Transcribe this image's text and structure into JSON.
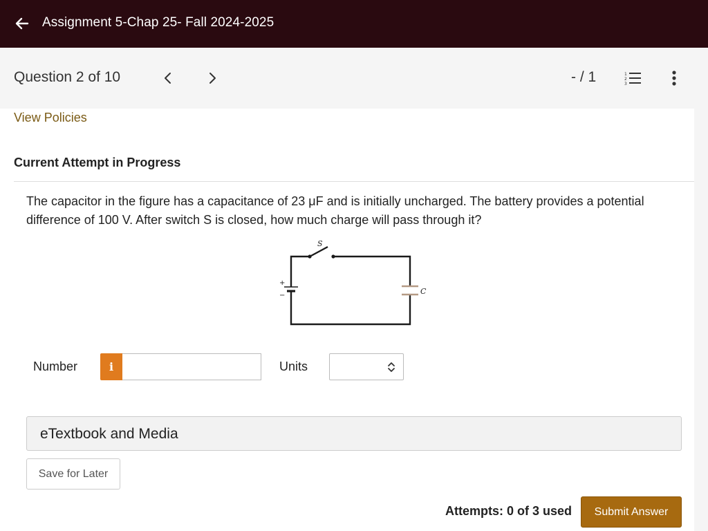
{
  "header": {
    "back_icon": "arrow-left-icon",
    "title": "Assignment 5-Chap 25- Fall 2024-2025"
  },
  "question_nav": {
    "counter": "Question 2 of 10",
    "prev_icon": "chevron-left-icon",
    "next_icon": "chevron-right-icon",
    "score": "- / 1",
    "list_icon": "numbered-list-icon",
    "more_icon": "more-vertical-icon"
  },
  "policies_link": "View Policies",
  "attempt_heading": "Current Attempt in Progress",
  "question": {
    "text": "The capacitor in the figure has a capacitance of 23 μF and is initially uncharged. The battery provides a potential difference of 100 V. After switch S is closed, how much charge will pass through it?",
    "figure": {
      "switch_label": "S",
      "capacitor_label": "C",
      "battery_plus": "+",
      "battery_minus": "−"
    }
  },
  "answer": {
    "number_label": "Number",
    "info_icon": "info-icon",
    "number_value": "",
    "units_label": "Units",
    "units_value": ""
  },
  "etextbook_label": "eTextbook and Media",
  "save_label": "Save for Later",
  "attempts_text": "Attempts: 0 of 3 used",
  "submit_label": "Submit Answer",
  "colors": {
    "header_bg": "#2a0a10",
    "link": "#7a5a14",
    "info_orange": "#e07b1e",
    "submit_bg": "#a76a10"
  }
}
